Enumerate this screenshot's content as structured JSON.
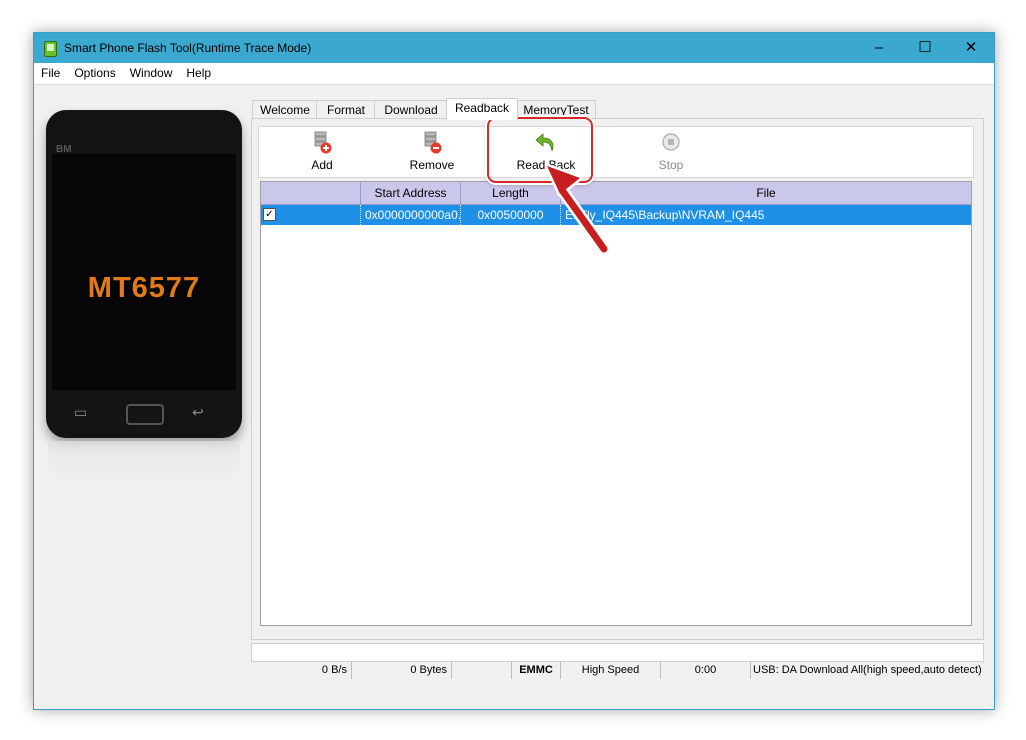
{
  "window": {
    "title": "Smart Phone Flash Tool(Runtime Trace Mode)",
    "minimize": "–",
    "maximize": "☐",
    "close": "✕"
  },
  "menu": [
    "File",
    "Options",
    "Window",
    "Help"
  ],
  "phone": {
    "brand": "BM",
    "chip": "MT6577"
  },
  "tabs": [
    "Welcome",
    "Format",
    "Download",
    "Readback",
    "MemoryTest"
  ],
  "active_tab": "Readback",
  "toolbar": {
    "add": "Add",
    "remove": "Remove",
    "read_back": "Read Back",
    "stop": "Stop"
  },
  "table": {
    "columns": [
      "",
      "Start Address",
      "Length",
      "File"
    ],
    "rows": [
      {
        "checked": true,
        "start_address": "0x0000000000a0...",
        "length": "0x00500000",
        "file": "E:\\Fly_IQ445\\Backup\\NVRAM_IQ445"
      }
    ]
  },
  "status": {
    "speed": "0 B/s",
    "bytes": "0 Bytes",
    "blank": "",
    "storage": "EMMC",
    "mode": "High Speed",
    "time": "0:00",
    "usb": "USB: DA Download All(high speed,auto detect)"
  },
  "colors": {
    "titlebar": "#3ba8cf",
    "selection": "#1e90e6",
    "header": "#c9c8ea",
    "callout": "#d12b2b",
    "chip_text": "#e07a1b"
  }
}
